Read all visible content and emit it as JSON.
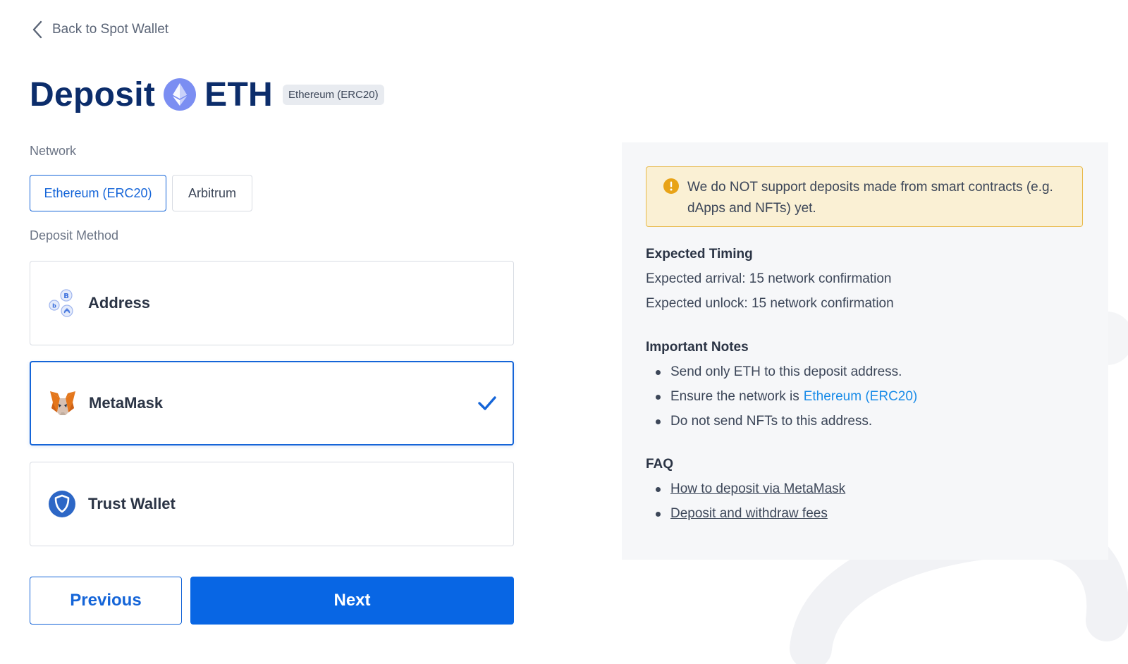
{
  "back": {
    "label": "Back to Spot Wallet",
    "icon": "chevron-left-icon"
  },
  "title": {
    "prefix": "Deposit",
    "coin": "ETH",
    "network_badge": "Ethereum (ERC20)",
    "coin_icon": "ethereum-icon"
  },
  "network": {
    "label": "Network",
    "options": [
      {
        "label": "Ethereum (ERC20)",
        "selected": true
      },
      {
        "label": "Arbitrum",
        "selected": false
      }
    ]
  },
  "deposit_method": {
    "label": "Deposit Method",
    "options": [
      {
        "label": "Address",
        "icon": "coins-address-icon",
        "selected": false
      },
      {
        "label": "MetaMask",
        "icon": "metamask-fox-icon",
        "selected": true
      },
      {
        "label": "Trust Wallet",
        "icon": "trust-wallet-shield-icon",
        "selected": false
      }
    ]
  },
  "actions": {
    "previous": "Previous",
    "next": "Next"
  },
  "info": {
    "warning": "We do NOT support deposits made from smart contracts (e.g. dApps and NFTs) yet.",
    "timing": {
      "title": "Expected Timing",
      "arrival": "Expected arrival: 15 network confirmation",
      "unlock": "Expected unlock: 15 network confirmation"
    },
    "notes": {
      "title": "Important Notes",
      "items": [
        "Send only ETH to this deposit address.",
        "Ensure the network is",
        "Do not send NFTs to this address."
      ],
      "network_highlight": "Ethereum (ERC20)"
    },
    "faq": {
      "title": "FAQ",
      "links": [
        "How to deposit via MetaMask",
        "Deposit and withdraw fees"
      ]
    }
  },
  "colors": {
    "primary": "#0866e4",
    "title": "#0c2d6b",
    "warning_bg": "#faf0d4",
    "warning_border": "#e8b94a",
    "link": "#1a8ce8"
  }
}
